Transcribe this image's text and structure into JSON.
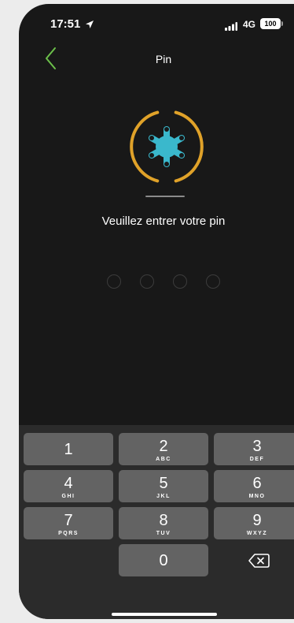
{
  "status_bar": {
    "time": "17:51",
    "network": "4G",
    "battery": "100"
  },
  "nav": {
    "title": "Pin"
  },
  "prompt": "Veuillez entrer votre pin",
  "pin": {
    "length": 4,
    "entered": 0
  },
  "keypad": {
    "keys": [
      {
        "digit": "1",
        "letters": ""
      },
      {
        "digit": "2",
        "letters": "ABC"
      },
      {
        "digit": "3",
        "letters": "DEF"
      },
      {
        "digit": "4",
        "letters": "GHI"
      },
      {
        "digit": "5",
        "letters": "JKL"
      },
      {
        "digit": "6",
        "letters": "MNO"
      },
      {
        "digit": "7",
        "letters": "PQRS"
      },
      {
        "digit": "8",
        "letters": "TUV"
      },
      {
        "digit": "9",
        "letters": "WXYZ"
      },
      {
        "digit": "0",
        "letters": ""
      }
    ]
  },
  "colors": {
    "accent_green": "#6cc04a",
    "emblem_ring": "#e0a229",
    "emblem_star": "#3ab8cc",
    "key_background": "#636363",
    "keypad_background": "#2b2b2b"
  }
}
